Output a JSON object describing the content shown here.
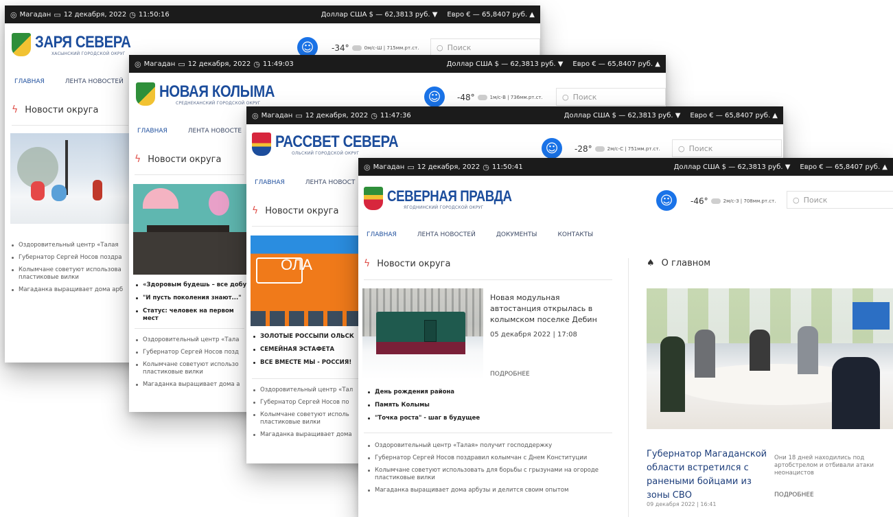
{
  "common": {
    "location": "Магадан",
    "date": "12 декабря, 2022",
    "usd": "Доллар США $ — 62,3813 руб. ▼",
    "eur": "Евро € — 65,8407 руб. ▲",
    "search_placeholder": "Поиск",
    "nav": [
      "ГЛАВНАЯ",
      "ЛЕНТА НОВОСТЕЙ",
      "ДОКУМЕНТЫ",
      "КОНТАКТЫ"
    ],
    "section_news": "Новости округа",
    "section_main": "О главном",
    "bottom_list": [
      "Оздоровительный центр «Талая» получит господдержку",
      "Губернатор Сергей Носов поздравил колымчан с Днем Конституции",
      "Колымчане советуют использовать для борьбы с грызунами на огороде пластиковые вилки",
      "Магаданка выращивает дома арбузы и делится своим опытом"
    ]
  },
  "cards": [
    {
      "time": "11:50:16",
      "logo_name": "ЗАРЯ СЕВЕРА",
      "logo_sub": "ХАСЫНСКИЙ ГОРОДСКОЙ ОКРУГ",
      "temp": "-34°",
      "weather": "0м/с-Ш | 715мм.рт.ст.",
      "nav_first": "ГЛАВНАЯ",
      "nav_second": "ЛЕНТА НОВОСТЕЙ",
      "list": [
        "Оздоровительный центр «Талая",
        "Губернатор Сергей Носов поздра",
        "Колымчане советуют использова",
        "пластиковые вилки",
        "Магаданка выращивает дома арб"
      ]
    },
    {
      "time": "11:49:03",
      "logo_name": "НОВАЯ КОЛЫМА",
      "logo_sub": "СРЕДНЕКАНСКИЙ ГОРОДСКОЙ ОКРУГ",
      "temp": "-48°",
      "weather": "1м/с-В | 736мм.рт.ст.",
      "nav_first": "ГЛАВНАЯ",
      "nav_second": "ЛЕНТА НОВОСТЕ",
      "featured": [
        "«Здоровым будешь – все добуд",
        "\"И пусть поколения знают...\"",
        "Статус: человек на первом мест"
      ],
      "list": [
        "Оздоровительный центр «Тала",
        "Губернатор Сергей Носов позд",
        "Колымчане советуют использо",
        "пластиковые вилки",
        "Магаданка выращивает дома а"
      ]
    },
    {
      "time": "11:47:36",
      "logo_name": "РАССВЕТ СЕВЕРА",
      "logo_sub": "ОЛЬСКИЙ ГОРОДСКОЙ ОКРУГ",
      "temp": "-28°",
      "weather": "2м/с-С | 751мм.рт.ст.",
      "nav_first": "ГЛАВНАЯ",
      "nav_second": "ЛЕНТА НОВОСТ",
      "sign": "ОЛА",
      "featured": [
        "ЗОЛОТЫЕ РОССЫПИ ОЛЬСК",
        "СЕМЕЙНАЯ ЭСТАФЕТА",
        "ВСЕ ВМЕСТЕ МЫ - РОССИЯ!"
      ],
      "list": [
        "Оздоровительный центр «Тал",
        "Губернатор Сергей Носов по",
        "Колымчане советуют исполь",
        "пластиковые вилки",
        "Магаданка выращивает дома"
      ]
    },
    {
      "time": "11:50:41",
      "logo_name": "СЕВЕРНАЯ ПРАВДА",
      "logo_sub": "ЯГОДНИНСКИЙ ГОРОДСКОЙ ОКРУГ",
      "temp": "-46°",
      "weather": "2м/с-З | 708мм.рт.ст.",
      "article_title": "Новая модульная автостанция открылась в колымском поселке Дебин",
      "article_date": "05 декабря 2022 | 17:08",
      "more": "ПОДРОБНЕЕ",
      "featured": [
        "День рождения района",
        "Память Колымы",
        "\"Точка роста\" - шаг в будущее"
      ],
      "main_title": "Губернатор Магаданской области встретился с ранеными бойцами из зоны СВО",
      "main_date": "09 декабря 2022 | 16:41",
      "main_desc": "Они 18 дней находились под артобстрелом и отбивали атаки неонацистов",
      "main_more": "ПОДРОБНЕЕ"
    }
  ],
  "colors": {
    "topbar": "#1b1b1b",
    "logo_blue": "#1c4d9c",
    "accessibility_blue": "#1a73e8",
    "bolt_red": "#e0504a"
  }
}
